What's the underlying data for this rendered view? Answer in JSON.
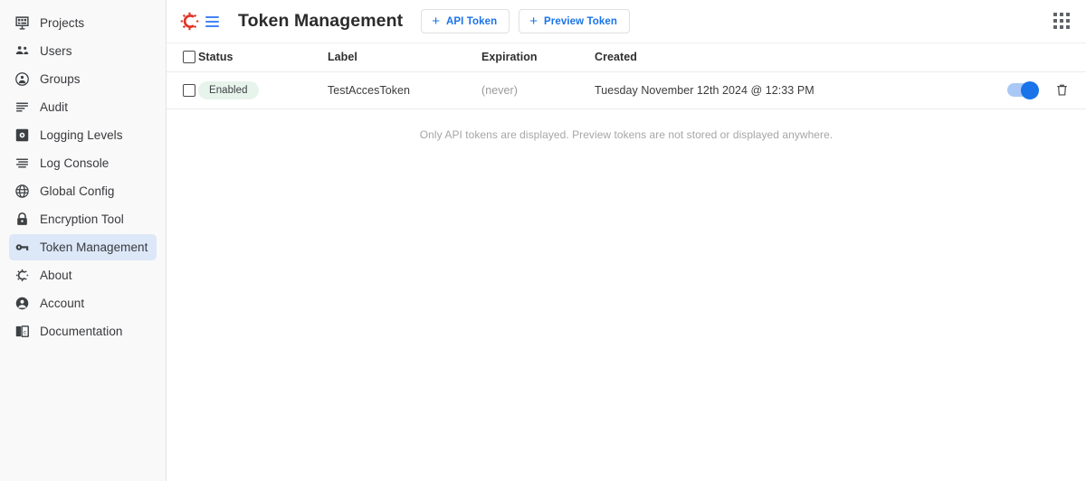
{
  "sidebar": {
    "items": [
      {
        "label": "Projects",
        "icon": "projects-icon",
        "active": false
      },
      {
        "label": "Users",
        "icon": "users-icon",
        "active": false
      },
      {
        "label": "Groups",
        "icon": "groups-icon",
        "active": false
      },
      {
        "label": "Audit",
        "icon": "audit-icon",
        "active": false
      },
      {
        "label": "Logging Levels",
        "icon": "logging-levels-icon",
        "active": false
      },
      {
        "label": "Log Console",
        "icon": "log-console-icon",
        "active": false
      },
      {
        "label": "Global Config",
        "icon": "globe-icon",
        "active": false
      },
      {
        "label": "Encryption Tool",
        "icon": "lock-icon",
        "active": false
      },
      {
        "label": "Token Management",
        "icon": "key-icon",
        "active": true
      },
      {
        "label": "About",
        "icon": "gear-c-icon",
        "active": false
      },
      {
        "label": "Account",
        "icon": "account-circle-icon",
        "active": false
      },
      {
        "label": "Documentation",
        "icon": "book-icon",
        "active": false
      }
    ]
  },
  "header": {
    "logo_icon": "conductor-gear-logo",
    "menu_icon": "hamburger-menu-icon",
    "title": "Token Management",
    "buttons": [
      {
        "label": "API Token",
        "icon": "plus-icon"
      },
      {
        "label": "Preview Token",
        "icon": "plus-icon"
      }
    ],
    "apps_icon": "apps-grid-icon"
  },
  "table": {
    "columns": [
      "Status",
      "Label",
      "Expiration",
      "Created"
    ],
    "rows": [
      {
        "status": "Enabled",
        "label": "TestAccesToken",
        "expiration": "(never)",
        "created": "Tuesday November 12th 2024 @ 12:33 PM",
        "toggle_on": true,
        "delete_icon": "trash-icon"
      }
    ]
  },
  "footnote": "Only API tokens are displayed. Preview tokens are not stored or displayed anywhere.",
  "colors": {
    "accent_blue": "#1a73e8",
    "logo_red": "#e03427",
    "badge_green_bg": "#e7f4ec",
    "active_nav_bg": "#dce7f8",
    "sidebar_bg": "#f9f9f9"
  }
}
